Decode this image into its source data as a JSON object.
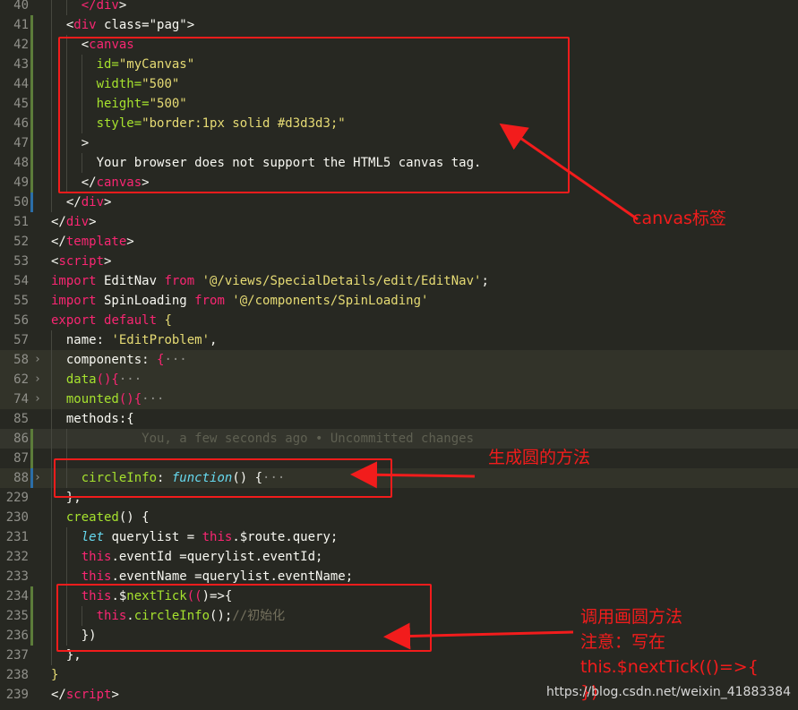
{
  "lines": [
    {
      "n": "40",
      "indent": 2,
      "tokens": [
        {
          "t": "</",
          "c": "tag"
        },
        {
          "t": "div",
          "c": "tag"
        },
        {
          "t": ">",
          "c": "plain"
        }
      ]
    },
    {
      "n": "41",
      "indent": 1,
      "tokens": [
        {
          "t": "<",
          "c": "plain"
        },
        {
          "t": "div",
          "c": "tag"
        },
        {
          "t": " class=\"pag\">",
          "c": "plain"
        }
      ]
    },
    {
      "n": "42",
      "indent": 2,
      "tokens": [
        {
          "t": "<",
          "c": "plain"
        },
        {
          "t": "canvas",
          "c": "tag"
        }
      ]
    },
    {
      "n": "43",
      "indent": 3,
      "tokens": [
        {
          "t": "id=",
          "c": "attr"
        },
        {
          "t": "\"myCanvas\"",
          "c": "str"
        }
      ]
    },
    {
      "n": "44",
      "indent": 3,
      "tokens": [
        {
          "t": "width=",
          "c": "attr"
        },
        {
          "t": "\"500\"",
          "c": "str"
        }
      ]
    },
    {
      "n": "45",
      "indent": 3,
      "tokens": [
        {
          "t": "height=",
          "c": "attr"
        },
        {
          "t": "\"500\"",
          "c": "str"
        }
      ]
    },
    {
      "n": "46",
      "indent": 3,
      "tokens": [
        {
          "t": "style=",
          "c": "attr"
        },
        {
          "t": "\"border:1px solid #d3d3d3;\"",
          "c": "str"
        }
      ]
    },
    {
      "n": "47",
      "indent": 2,
      "tokens": [
        {
          "t": ">",
          "c": "plain"
        }
      ]
    },
    {
      "n": "48",
      "indent": 3,
      "tokens": [
        {
          "t": "Your browser does not support the HTML5 canvas tag.",
          "c": "plain"
        }
      ]
    },
    {
      "n": "49",
      "indent": 2,
      "tokens": [
        {
          "t": "</",
          "c": "plain"
        },
        {
          "t": "canvas",
          "c": "tag"
        },
        {
          "t": ">",
          "c": "plain"
        }
      ]
    },
    {
      "n": "50",
      "indent": 1,
      "tokens": [
        {
          "t": "</",
          "c": "plain"
        },
        {
          "t": "div",
          "c": "tag"
        },
        {
          "t": ">",
          "c": "plain"
        }
      ]
    },
    {
      "n": "51",
      "indent": 0,
      "tokens": [
        {
          "t": "</",
          "c": "plain"
        },
        {
          "t": "div",
          "c": "tag"
        },
        {
          "t": ">",
          "c": "plain"
        }
      ]
    },
    {
      "n": "52",
      "indent": 0,
      "tokens": [
        {
          "t": "</",
          "c": "plain"
        },
        {
          "t": "template",
          "c": "tag"
        },
        {
          "t": ">",
          "c": "plain"
        }
      ]
    },
    {
      "n": "53",
      "indent": 0,
      "tokens": [
        {
          "t": "<",
          "c": "plain"
        },
        {
          "t": "script",
          "c": "tag"
        },
        {
          "t": ">",
          "c": "plain"
        }
      ]
    },
    {
      "n": "54",
      "indent": 0,
      "tokens": [
        {
          "t": "import",
          "c": "kw"
        },
        {
          "t": " EditNav ",
          "c": "plain"
        },
        {
          "t": "from",
          "c": "kw"
        },
        {
          "t": " '@/views/SpecialDetails/edit/EditNav'",
          "c": "str"
        },
        {
          "t": ";",
          "c": "plain"
        }
      ]
    },
    {
      "n": "55",
      "indent": 0,
      "tokens": [
        {
          "t": "import",
          "c": "kw"
        },
        {
          "t": " SpinLoading ",
          "c": "plain"
        },
        {
          "t": "from",
          "c": "kw"
        },
        {
          "t": " '@/components/SpinLoading'",
          "c": "str"
        }
      ]
    },
    {
      "n": "56",
      "indent": 0,
      "tokens": [
        {
          "t": "export",
          "c": "kw"
        },
        {
          "t": " ",
          "c": "plain"
        },
        {
          "t": "default",
          "c": "kw"
        },
        {
          "t": " {",
          "c": "str"
        }
      ]
    },
    {
      "n": "57",
      "indent": 1,
      "tokens": [
        {
          "t": "name: ",
          "c": "plain"
        },
        {
          "t": "'EditProblem'",
          "c": "str"
        },
        {
          "t": ",",
          "c": "plain"
        }
      ]
    },
    {
      "n": "58",
      "indent": 1,
      "collapsed": true,
      "fold": true,
      "tokens": [
        {
          "t": "components: ",
          "c": "plain"
        },
        {
          "t": "{",
          "c": "kw"
        },
        {
          "t": "···",
          "c": "ellipsis"
        }
      ]
    },
    {
      "n": "62",
      "indent": 1,
      "collapsed": true,
      "fold": true,
      "tokens": [
        {
          "t": "data",
          "c": "fn"
        },
        {
          "t": "(){",
          "c": "kw"
        },
        {
          "t": "···",
          "c": "ellipsis"
        }
      ]
    },
    {
      "n": "74",
      "indent": 1,
      "collapsed": true,
      "fold": true,
      "tokens": [
        {
          "t": "mounted",
          "c": "fn"
        },
        {
          "t": "(){",
          "c": "kw"
        },
        {
          "t": "···",
          "c": "ellipsis"
        }
      ]
    },
    {
      "n": "85",
      "indent": 1,
      "tokens": [
        {
          "t": "methods:",
          "c": "plain"
        },
        {
          "t": "{",
          "c": "brace"
        }
      ]
    },
    {
      "n": "86",
      "indent": 2,
      "current": true,
      "tokens": [
        {
          "t": "        You, a few seconds ago • Uncommitted changes",
          "c": "ghost"
        }
      ]
    },
    {
      "n": "87",
      "indent": 2,
      "tokens": []
    },
    {
      "n": "88",
      "indent": 2,
      "collapsed": true,
      "fold": true,
      "tokens": [
        {
          "t": "circleInfo",
          "c": "fn"
        },
        {
          "t": ": ",
          "c": "plain"
        },
        {
          "t": "function",
          "c": "func"
        },
        {
          "t": "() {",
          "c": "plain"
        },
        {
          "t": "···",
          "c": "ellipsis"
        }
      ]
    },
    {
      "n": "229",
      "indent": 1,
      "tokens": [
        {
          "t": "}",
          "c": "brace"
        },
        {
          "t": ",",
          "c": "plain"
        }
      ]
    },
    {
      "n": "230",
      "indent": 1,
      "tokens": [
        {
          "t": "created",
          "c": "fn"
        },
        {
          "t": "() {",
          "c": "plain"
        }
      ]
    },
    {
      "n": "231",
      "indent": 2,
      "tokens": [
        {
          "t": "let",
          "c": "let"
        },
        {
          "t": " querylist = ",
          "c": "plain"
        },
        {
          "t": "this",
          "c": "this"
        },
        {
          "t": ".$route.query;",
          "c": "plain"
        }
      ]
    },
    {
      "n": "232",
      "indent": 2,
      "tokens": [
        {
          "t": "this",
          "c": "this"
        },
        {
          "t": ".eventId =querylist.eventId;",
          "c": "plain"
        }
      ]
    },
    {
      "n": "233",
      "indent": 2,
      "tokens": [
        {
          "t": "this",
          "c": "this"
        },
        {
          "t": ".eventName =querylist.eventName;",
          "c": "plain"
        }
      ]
    },
    {
      "n": "234",
      "indent": 2,
      "tokens": [
        {
          "t": "this",
          "c": "this"
        },
        {
          "t": ".$",
          "c": "plain"
        },
        {
          "t": "nextTick",
          "c": "fn"
        },
        {
          "t": "((",
          "c": "kw"
        },
        {
          "t": ")=>{",
          "c": "plain"
        }
      ]
    },
    {
      "n": "235",
      "indent": 3,
      "tokens": [
        {
          "t": "this",
          "c": "this"
        },
        {
          "t": ".",
          "c": "plain"
        },
        {
          "t": "circleInfo",
          "c": "fn"
        },
        {
          "t": "();",
          "c": "plain"
        },
        {
          "t": "//初始化",
          "c": "cmt"
        }
      ]
    },
    {
      "n": "236",
      "indent": 2,
      "tokens": [
        {
          "t": "})",
          "c": "plain"
        }
      ]
    },
    {
      "n": "237",
      "indent": 1,
      "tokens": [
        {
          "t": "},",
          "c": "plain"
        }
      ]
    },
    {
      "n": "238",
      "indent": 0,
      "tokens": [
        {
          "t": "}",
          "c": "str"
        }
      ]
    },
    {
      "n": "239",
      "indent": 0,
      "tokens": [
        {
          "t": "</",
          "c": "plain"
        },
        {
          "t": "script",
          "c": "tag"
        },
        {
          "t": ">",
          "c": "plain"
        }
      ]
    }
  ],
  "annotations": {
    "canvas_label": "canvas标签",
    "circle_method_label": "生成圆的方法",
    "call_method_label": "调用画圆方法",
    "note_line1": "注意：写在",
    "note_line2": "this.$nextTick(()=>{",
    "note_line3": "})"
  },
  "watermark": "https://blog.csdn.net/weixin_41883384",
  "colors": {
    "background": "#272822",
    "annotation_red": "#f21c1c"
  }
}
